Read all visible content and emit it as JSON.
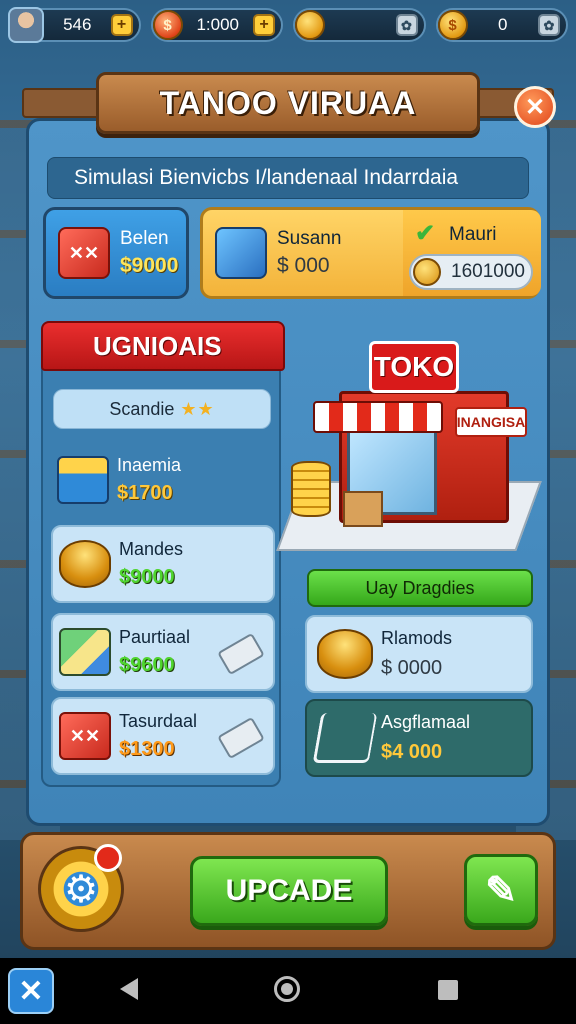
{
  "hud": {
    "player_value": "546",
    "currency_1_value": "1:000",
    "currency_2_value": "",
    "currency_3_value": "0",
    "plus_symbol": "+",
    "gear_symbol": "✿"
  },
  "header": {
    "title": "TANOO VIRUAA",
    "close_symbol": "✕"
  },
  "subtitle": "Simulasi Bienvicbs I/landenaal Indarrdaia",
  "stats": {
    "left": {
      "label": "Belen",
      "price": "$9000"
    },
    "middle": {
      "label": "Susann",
      "price": "$ 000"
    },
    "right": {
      "label": "Mauri",
      "balance": "1601000"
    }
  },
  "list": {
    "header": "UGNIOAIS",
    "filter": {
      "label": "Scandie",
      "stars": "★★"
    },
    "items": [
      {
        "name": "Inaemia",
        "price": "$1700",
        "icon": "basket-icon"
      },
      {
        "name": "Mandes",
        "price": "$9000",
        "icon": "coins-icon"
      },
      {
        "name": "Paurtiaal",
        "price": "$9600",
        "icon": "papers-icon"
      },
      {
        "name": "Tasurdaal",
        "price": "$1300",
        "icon": "cube-icon"
      }
    ]
  },
  "shop": {
    "sign": "TOKO",
    "side_sign": "INANGISA"
  },
  "right_panel": {
    "button_label": "Uay Dragdies",
    "cards": [
      {
        "name": "Rlamods",
        "price": "$ 0000",
        "icon": "coins-icon"
      },
      {
        "name": "Asgflamaal",
        "price": "$4 000",
        "icon": "cart-icon"
      }
    ]
  },
  "bottom": {
    "upgrade_label": "UPCADE",
    "settings_symbol": "⚙",
    "confirm_symbol": "✎"
  },
  "nav": {
    "x_symbol": "✕"
  },
  "colors": {
    "panel_blue": "#4f95c9",
    "accent_red": "#e22a1a",
    "accent_green": "#3aa81c",
    "wood": "#c98a4e"
  }
}
